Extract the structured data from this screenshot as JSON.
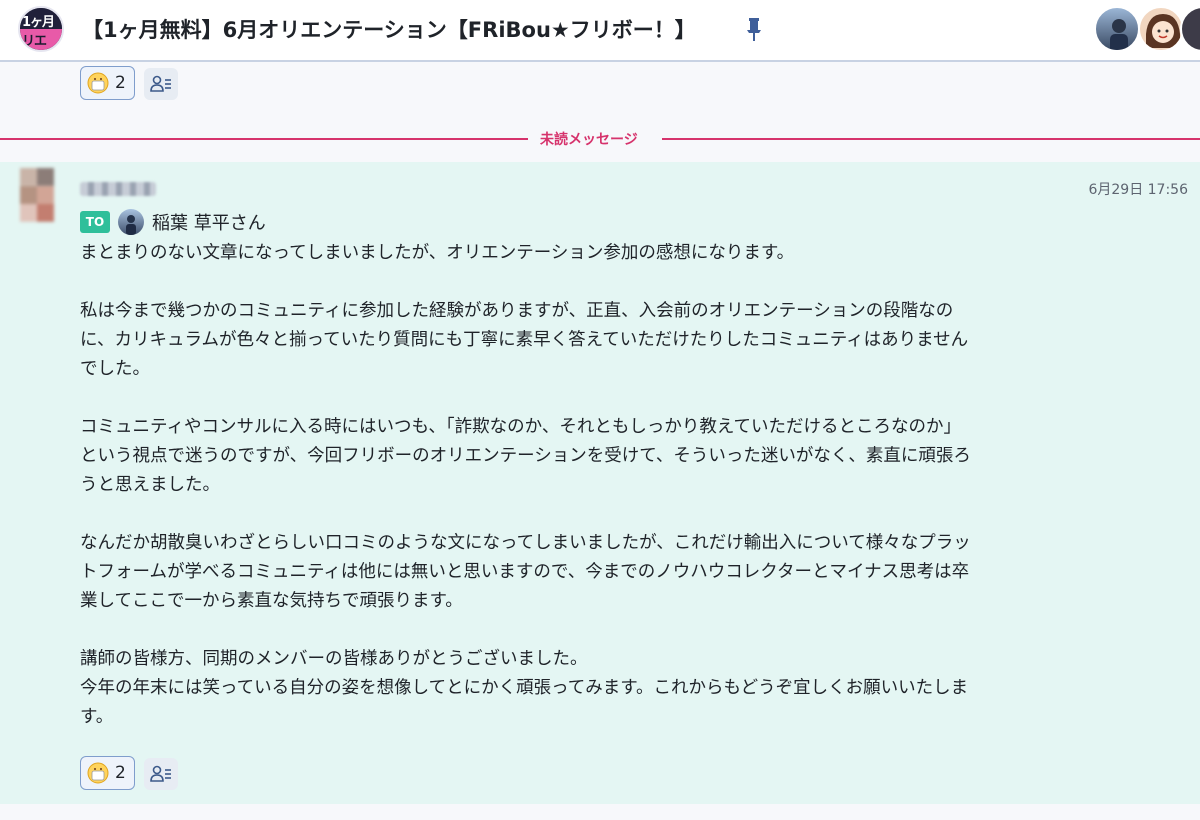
{
  "header": {
    "room_title": "【1ヶ月無料】6月オリエンテーション【FRiBou★フリボー！】",
    "room_icon_text_1": "1ヶ月",
    "room_icon_text_2": "リエ"
  },
  "prev_message": {
    "reaction_count": "2"
  },
  "unread_divider": {
    "label": "未読メッセージ"
  },
  "message": {
    "timestamp": "6月29日 17:56",
    "to_badge": "TO",
    "to_name": "稲葉 草平さん",
    "body": [
      [
        "まとまりのない文章になってしまいましたが、オリエンテーション参加の感想になります。"
      ],
      [
        "私は今まで幾つかのコミュニティに参加した経験がありますが、正直、入会前のオリエンテーションの段階なの",
        "に、カリキュラムが色々と揃っていたり質問にも丁寧に素早く答えていただけたりしたコミュニティはありません",
        "でした。"
      ],
      [
        "コミュニティやコンサルに入る時にはいつも、「詐欺なのか、それともしっかり教えていただけるところなのか」",
        "という視点で迷うのですが、今回フリボーのオリエンテーションを受けて、そういった迷いがなく、素直に頑張ろ",
        "うと思えました。"
      ],
      [
        "なんだか胡散臭いわざとらしい口コミのような文になってしまいましたが、これだけ輸出入について様々なプラッ",
        "トフォームが学べるコミュニティは他には無いと思いますので、今までのノウハウコレクターとマイナス思考は卒",
        "業してここで一から素直な気持ちで頑張ります。"
      ],
      [
        "講師の皆様方、同期のメンバーの皆様ありがとうございました。",
        "今年の年末には笑っている自分の姿を想像してとにかく頑張ってみます。これからもどうぞ宜しくお願いいたしま",
        "す。"
      ]
    ],
    "reaction_count": "2"
  }
}
